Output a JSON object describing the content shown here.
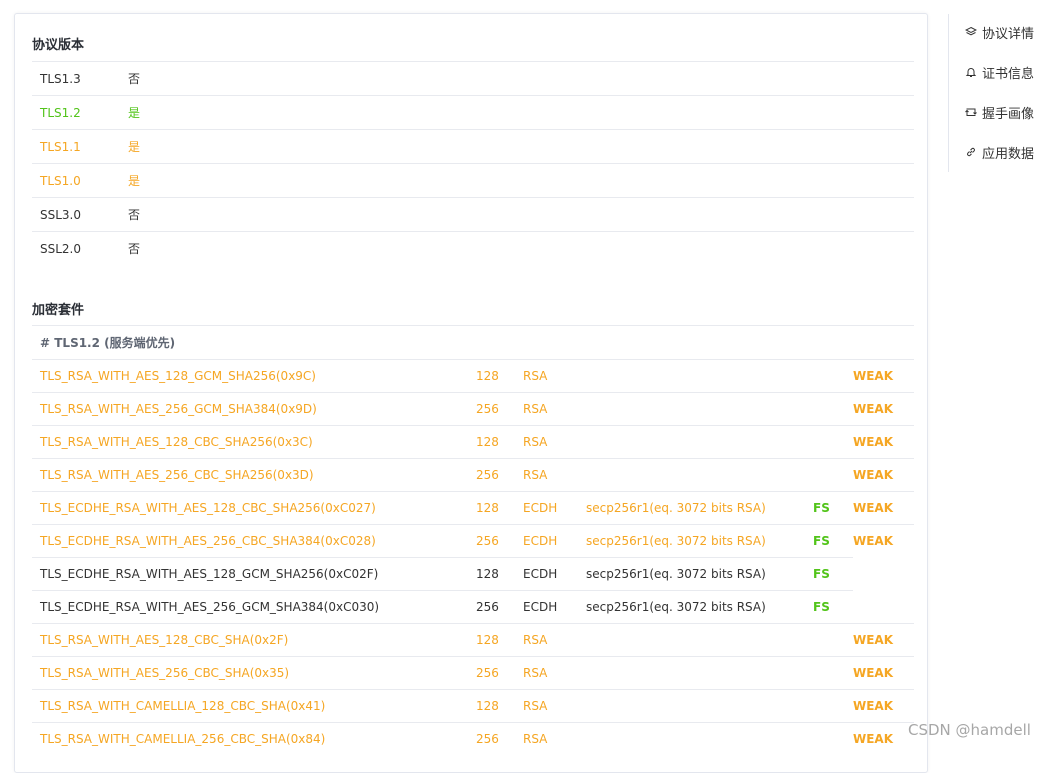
{
  "colors": {
    "green": "#52c41a",
    "orange": "#f5a623",
    "text": "#333333",
    "border": "#e8eaef"
  },
  "protocol_section": {
    "title": "协议版本",
    "rows": [
      {
        "name": "TLS1.3",
        "value": "否",
        "status": "normal"
      },
      {
        "name": "TLS1.2",
        "value": "是",
        "status": "green"
      },
      {
        "name": "TLS1.1",
        "value": "是",
        "status": "orange"
      },
      {
        "name": "TLS1.0",
        "value": "是",
        "status": "orange"
      },
      {
        "name": "SSL3.0",
        "value": "否",
        "status": "normal"
      },
      {
        "name": "SSL2.0",
        "value": "否",
        "status": "normal"
      }
    ]
  },
  "cipher_section": {
    "title": "加密套件",
    "group_header": "# TLS1.2 (服务端优先)",
    "rows": [
      {
        "name": "TLS_RSA_WITH_AES_128_GCM_SHA256(0x9C)",
        "bits": "128",
        "kex": "RSA",
        "curve": "",
        "fs": "",
        "weak": "WEAK",
        "status": "orange"
      },
      {
        "name": "TLS_RSA_WITH_AES_256_GCM_SHA384(0x9D)",
        "bits": "256",
        "kex": "RSA",
        "curve": "",
        "fs": "",
        "weak": "WEAK",
        "status": "orange"
      },
      {
        "name": "TLS_RSA_WITH_AES_128_CBC_SHA256(0x3C)",
        "bits": "128",
        "kex": "RSA",
        "curve": "",
        "fs": "",
        "weak": "WEAK",
        "status": "orange"
      },
      {
        "name": "TLS_RSA_WITH_AES_256_CBC_SHA256(0x3D)",
        "bits": "256",
        "kex": "RSA",
        "curve": "",
        "fs": "",
        "weak": "WEAK",
        "status": "orange"
      },
      {
        "name": "TLS_ECDHE_RSA_WITH_AES_128_CBC_SHA256(0xC027)",
        "bits": "128",
        "kex": "ECDH",
        "curve": "secp256r1(eq. 3072 bits RSA)",
        "fs": "FS",
        "weak": "WEAK",
        "status": "orange"
      },
      {
        "name": "TLS_ECDHE_RSA_WITH_AES_256_CBC_SHA384(0xC028)",
        "bits": "256",
        "kex": "ECDH",
        "curve": "secp256r1(eq. 3072 bits RSA)",
        "fs": "FS",
        "weak": "WEAK",
        "status": "orange"
      },
      {
        "name": "TLS_ECDHE_RSA_WITH_AES_128_GCM_SHA256(0xC02F)",
        "bits": "128",
        "kex": "ECDH",
        "curve": "secp256r1(eq. 3072 bits RSA)",
        "fs": "FS",
        "weak": "",
        "status": "normal"
      },
      {
        "name": "TLS_ECDHE_RSA_WITH_AES_256_GCM_SHA384(0xC030)",
        "bits": "256",
        "kex": "ECDH",
        "curve": "secp256r1(eq. 3072 bits RSA)",
        "fs": "FS",
        "weak": "",
        "status": "normal"
      },
      {
        "name": "TLS_RSA_WITH_AES_128_CBC_SHA(0x2F)",
        "bits": "128",
        "kex": "RSA",
        "curve": "",
        "fs": "",
        "weak": "WEAK",
        "status": "orange"
      },
      {
        "name": "TLS_RSA_WITH_AES_256_CBC_SHA(0x35)",
        "bits": "256",
        "kex": "RSA",
        "curve": "",
        "fs": "",
        "weak": "WEAK",
        "status": "orange"
      },
      {
        "name": "TLS_RSA_WITH_CAMELLIA_128_CBC_SHA(0x41)",
        "bits": "128",
        "kex": "RSA",
        "curve": "",
        "fs": "",
        "weak": "WEAK",
        "status": "orange"
      },
      {
        "name": "TLS_RSA_WITH_CAMELLIA_256_CBC_SHA(0x84)",
        "bits": "256",
        "kex": "RSA",
        "curve": "",
        "fs": "",
        "weak": "WEAK",
        "status": "orange"
      }
    ]
  },
  "side_nav": {
    "items": [
      {
        "label": "协议详情",
        "icon": "layers-icon"
      },
      {
        "label": "证书信息",
        "icon": "bell-icon"
      },
      {
        "label": "握手画像",
        "icon": "swap-icon"
      },
      {
        "label": "应用数据",
        "icon": "link-icon"
      }
    ]
  },
  "watermark": "CSDN @hamdell"
}
